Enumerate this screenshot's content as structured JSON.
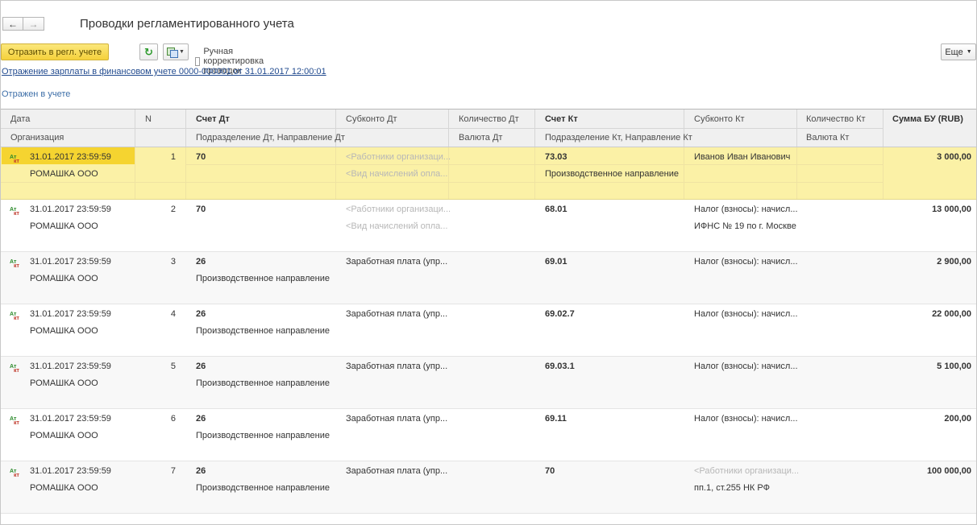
{
  "window": {
    "title": "Проводки регламентированного учета",
    "back_label": "←",
    "forward_label": "→"
  },
  "toolbar": {
    "reflect_button": "Отразить в регл. учете",
    "refresh_icon": "refresh-icon",
    "docs_icon": "documents-icon",
    "manual_correction_label": "Ручная корректировка проводок",
    "manual_correction_checked": false,
    "more_label": "Еще"
  },
  "document_link": "Отражение зарплаты в финансовом учете 0000-000001 от 31.01.2017 12:00:01",
  "status_text": "Отражен в учете",
  "table": {
    "headers": {
      "date": "Дата",
      "org": "Организация",
      "n": "N",
      "account_dt": "Счет Дт",
      "subdivision_dt": "Подразделение Дт, Направление Дт",
      "subconto_dt": "Субконто Дт",
      "qty_dt": "Количество Дт",
      "currency_dt": "Валюта Дт",
      "account_kt": "Счет Кт",
      "subdivision_kt": "Подразделение Кт, Направление Кт",
      "subconto_kt": "Субконто Кт",
      "qty_kt": "Количество Кт",
      "currency_kt": "Валюта Кт",
      "sum": "Сумма БУ (RUB)"
    },
    "rows": [
      {
        "date": "31.01.2017 23:59:59",
        "org": "РОМАШКА ООО",
        "n": "1",
        "account_dt": "70",
        "subdivision_dt": "",
        "subconto_dt_1": "<Работники организаци...",
        "subconto_dt_2": "<Вид начислений опла...",
        "account_kt": "73.03",
        "subdivision_kt": "Производственное направление",
        "subconto_kt_1": "Иванов Иван Иванович",
        "subconto_kt_2": "",
        "sum": "3 000,00"
      },
      {
        "date": "31.01.2017 23:59:59",
        "org": "РОМАШКА ООО",
        "n": "2",
        "account_dt": "70",
        "subdivision_dt": "",
        "subconto_dt_1": "<Работники организаци...",
        "subconto_dt_2": "<Вид начислений опла...",
        "account_kt": "68.01",
        "subdivision_kt": "",
        "subconto_kt_1": "Налог (взносы): начисл...",
        "subconto_kt_2": "ИФНС № 19 по г. Москве",
        "sum": "13 000,00"
      },
      {
        "date": "31.01.2017 23:59:59",
        "org": "РОМАШКА ООО",
        "n": "3",
        "account_dt": "26",
        "subdivision_dt": "Производственное направление",
        "subconto_dt_1": "Заработная плата (упр...",
        "subconto_dt_2": "",
        "account_kt": "69.01",
        "subdivision_kt": "",
        "subconto_kt_1": "Налог (взносы): начисл...",
        "subconto_kt_2": "",
        "sum": "2 900,00"
      },
      {
        "date": "31.01.2017 23:59:59",
        "org": "РОМАШКА ООО",
        "n": "4",
        "account_dt": "26",
        "subdivision_dt": "Производственное направление",
        "subconto_dt_1": "Заработная плата (упр...",
        "subconto_dt_2": "",
        "account_kt": "69.02.7",
        "subdivision_kt": "",
        "subconto_kt_1": "Налог (взносы): начисл...",
        "subconto_kt_2": "",
        "sum": "22 000,00"
      },
      {
        "date": "31.01.2017 23:59:59",
        "org": "РОМАШКА ООО",
        "n": "5",
        "account_dt": "26",
        "subdivision_dt": "Производственное направление",
        "subconto_dt_1": "Заработная плата (упр...",
        "subconto_dt_2": "",
        "account_kt": "69.03.1",
        "subdivision_kt": "",
        "subconto_kt_1": "Налог (взносы): начисл...",
        "subconto_kt_2": "",
        "sum": "5 100,00"
      },
      {
        "date": "31.01.2017 23:59:59",
        "org": "РОМАШКА ООО",
        "n": "6",
        "account_dt": "26",
        "subdivision_dt": "Производственное направление",
        "subconto_dt_1": "Заработная плата (упр...",
        "subconto_dt_2": "",
        "account_kt": "69.11",
        "subdivision_kt": "",
        "subconto_kt_1": "Налог (взносы): начисл...",
        "subconto_kt_2": "",
        "sum": "200,00"
      },
      {
        "date": "31.01.2017 23:59:59",
        "org": "РОМАШКА ООО",
        "n": "7",
        "account_dt": "26",
        "subdivision_dt": "Производственное направление",
        "subconto_dt_1": "Заработная плата (упр...",
        "subconto_dt_2": "",
        "account_kt": "70",
        "subdivision_kt": "",
        "subconto_kt_1": "<Работники организаци...",
        "subconto_kt_2": "пп.1, ст.255 НК РФ",
        "sum": "100 000,00"
      }
    ],
    "row_icon": "debit-credit-icon",
    "icon_text_a": "Ат",
    "icon_text_k": "кт"
  },
  "colors": {
    "primary_button": "#f5d13b",
    "selected_row": "#fbf1a6",
    "selected_cell": "#f5d430",
    "link": "#224b8f"
  }
}
